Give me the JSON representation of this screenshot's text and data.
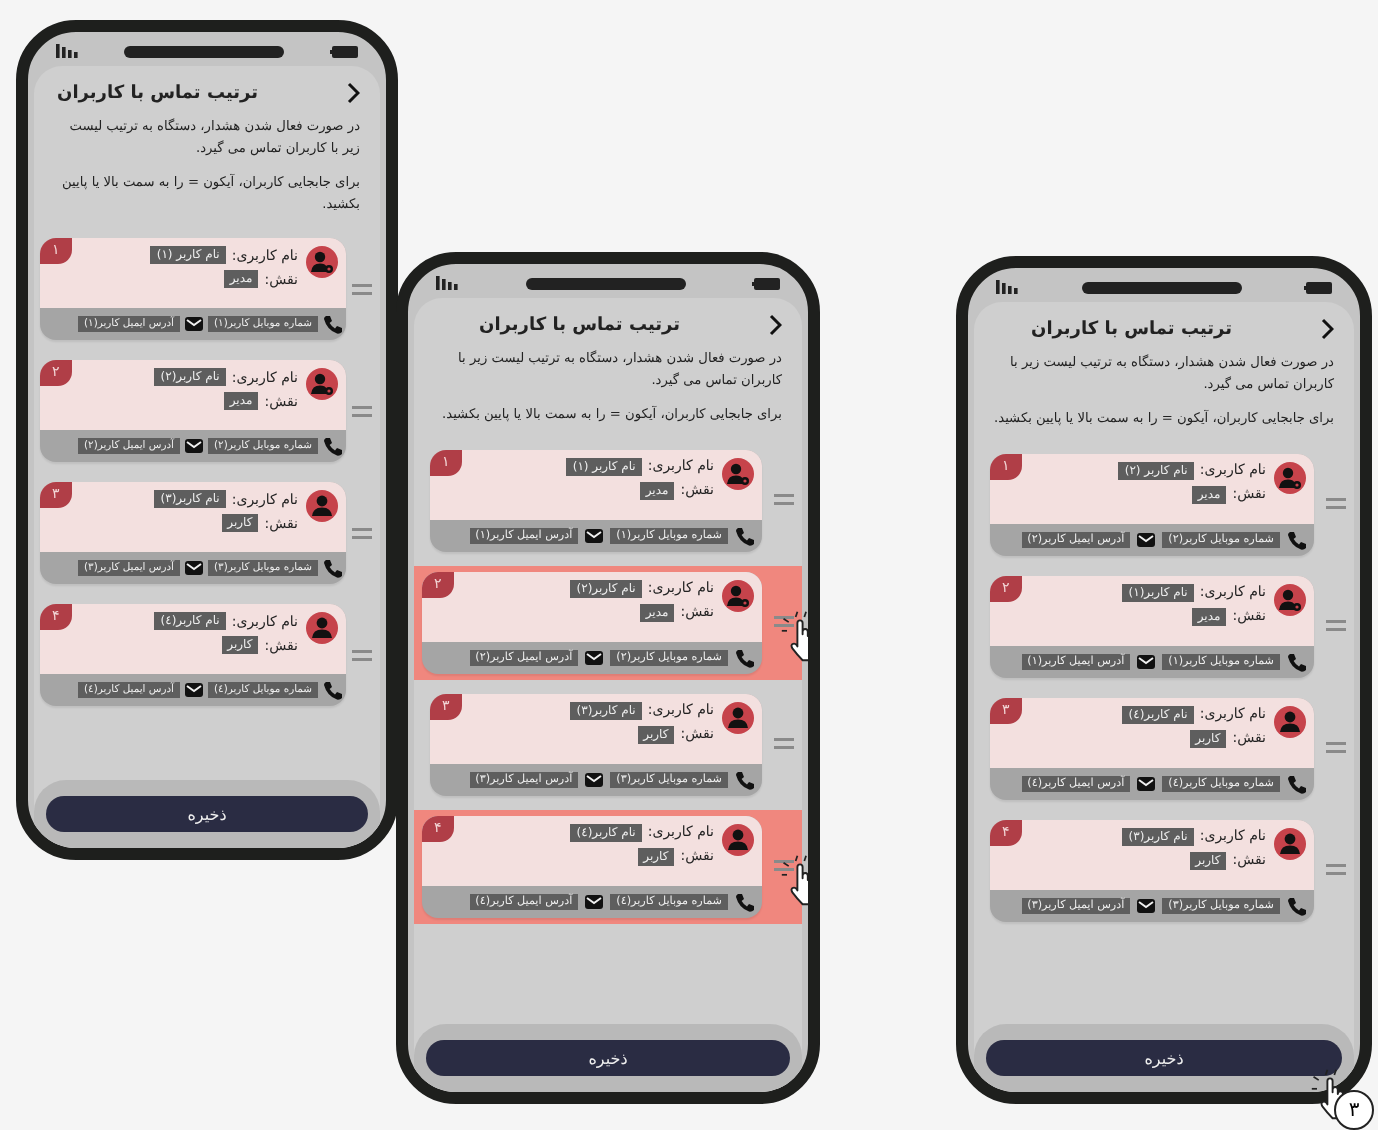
{
  "phones": [
    {
      "title": "ترتیب تماس با کاربران",
      "description": "در صورت فعال شدن هشدار، دستگاه به ترتیب لیست زیر با کاربران تماس می گیرد.",
      "hint": "برای جابجایی کاربران، آیکون = را به سمت بالا یا پایین بکشید.",
      "save_label": "ذخیره",
      "save_tapped": true,
      "step": "۳",
      "cards": [
        {
          "number": "۱",
          "name_label": "نام کاربری:",
          "name": "نام کاربر (۲)",
          "role_label": "نقش:",
          "role": "مدیر",
          "kind": "admin",
          "mobile": "شماره موبایل کاربر(۲)",
          "email": "آدرس ایمیل کاربر(۲)",
          "dragging": false
        },
        {
          "number": "۲",
          "name_label": "نام کاربری:",
          "name": "نام کاربر(۱)",
          "role_label": "نقش:",
          "role": "مدیر",
          "kind": "admin",
          "mobile": "شماره موبایل کاربر(۱)",
          "email": "آدرس ایمیل کاربر(۱)",
          "dragging": false
        },
        {
          "number": "۳",
          "name_label": "نام کاربری:",
          "name": "نام کاربر(٤)",
          "role_label": "نقش:",
          "role": "کاربر",
          "kind": "user",
          "mobile": "شماره موبایل کاربر(٤)",
          "email": "آدرس ایمیل کاربر(٤)",
          "dragging": false
        },
        {
          "number": "۴",
          "name_label": "نام کاربری:",
          "name": "نام کاربر(۳)",
          "role_label": "نقش:",
          "role": "کاربر",
          "kind": "user",
          "mobile": "شماره موبایل کاربر(۳)",
          "email": "آدرس ایمیل کاربر(۳)",
          "dragging": false
        }
      ]
    },
    {
      "title": "ترتیب تماس با کاربران",
      "description": "در صورت فعال شدن هشدار، دستگاه به ترتیب لیست زیر با کاربران تماس می گیرد.",
      "hint": "برای جابجایی کاربران، آیکون = را به سمت بالا یا پایین بکشید.",
      "save_label": "ذخیره",
      "save_tapped": false,
      "cards": [
        {
          "number": "۱",
          "name_label": "نام کاربری:",
          "name": "نام کاربر (۱)",
          "role_label": "نقش:",
          "role": "مدیر",
          "kind": "admin",
          "mobile": "شماره موبایل کاربر(۱)",
          "email": "آدرس ایمیل کاربر(۱)",
          "dragging": false
        },
        {
          "number": "۲",
          "name_label": "نام کاربری:",
          "name": "نام کاربر(۲)",
          "role_label": "نقش:",
          "role": "مدیر",
          "kind": "admin",
          "mobile": "شماره موبایل کاربر(۲)",
          "email": "آدرس ایمیل کاربر(۲)",
          "dragging": true
        },
        {
          "number": "۳",
          "name_label": "نام کاربری:",
          "name": "نام کاربر(۳)",
          "role_label": "نقش:",
          "role": "کاربر",
          "kind": "user",
          "mobile": "شماره موبایل کاربر(۳)",
          "email": "آدرس ایمیل کاربر(۳)",
          "dragging": false
        },
        {
          "number": "۴",
          "name_label": "نام کاربری:",
          "name": "نام کاربر(٤)",
          "role_label": "نقش:",
          "role": "کاربر",
          "kind": "user",
          "mobile": "شماره موبایل کاربر(٤)",
          "email": "آدرس ایمیل کاربر(٤)",
          "dragging": true
        }
      ]
    },
    {
      "title": "ترتیب تماس با کاربران",
      "description": "در صورت فعال شدن هشدار، دستگاه به ترتیب لیست زیر با کاربران تماس می گیرد.",
      "hint": "برای جابجایی کاربران، آیکون = را به سمت بالا یا پایین بکشید.",
      "save_label": "ذخیره",
      "save_tapped": false,
      "cards": [
        {
          "number": "۱",
          "name_label": "نام کاربری:",
          "name": "نام کاربر (۱)",
          "role_label": "نقش:",
          "role": "مدیر",
          "kind": "admin",
          "mobile": "شماره موبایل کاربر(۱)",
          "email": "آدرس ایمیل کاربر(۱)",
          "dragging": false
        },
        {
          "number": "۲",
          "name_label": "نام کاربری:",
          "name": "نام کاربر(۲)",
          "role_label": "نقش:",
          "role": "مدیر",
          "kind": "admin",
          "mobile": "شماره موبایل کاربر(۲)",
          "email": "آدرس ایمیل کاربر(۲)",
          "dragging": false
        },
        {
          "number": "۳",
          "name_label": "نام کاربری:",
          "name": "نام کاربر(۳)",
          "role_label": "نقش:",
          "role": "کاربر",
          "kind": "user",
          "mobile": "شماره موبایل کاربر(۳)",
          "email": "آدرس ایمیل کاربر(۳)",
          "dragging": false
        },
        {
          "number": "۴",
          "name_label": "نام کاربری:",
          "name": "نام کاربر(٤)",
          "role_label": "نقش:",
          "role": "کاربر",
          "kind": "user",
          "mobile": "شماره موبایل کاربر(٤)",
          "email": "آدرس ایمیل کاربر(٤)",
          "dragging": false
        }
      ]
    }
  ]
}
